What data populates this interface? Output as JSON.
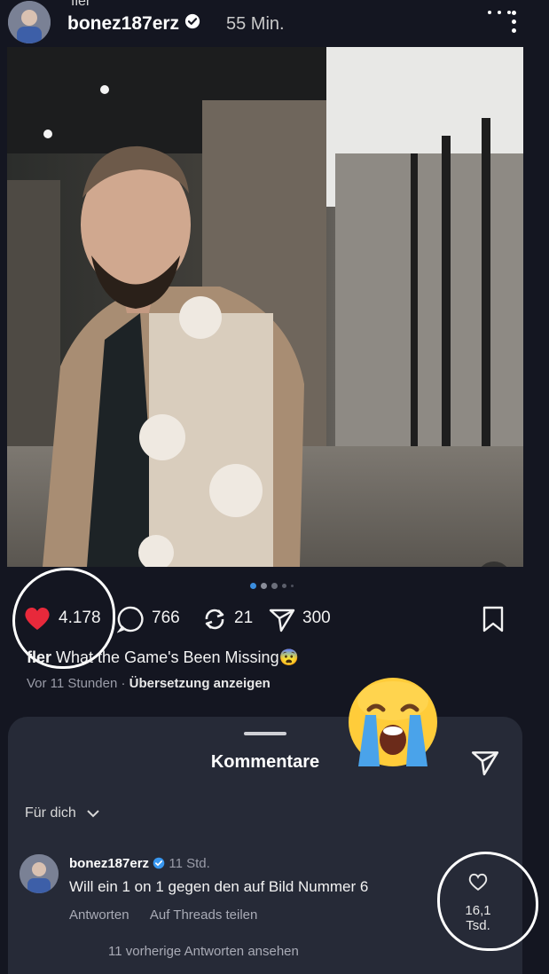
{
  "story": {
    "author_label": "fler",
    "username": "bonez187erz",
    "time": "55 Min."
  },
  "post": {
    "likes": "4.178",
    "comments": "766",
    "reposts": "21",
    "shares": "300",
    "caption_user": "fler",
    "caption_text": "What the Game's Been Missing",
    "caption_emoji": "😨",
    "time": "Vor 11 Stunden",
    "separator": "·",
    "translate_label": "Übersetzung anzeigen",
    "carousel_position": 1,
    "carousel_count": 5
  },
  "overlay_emoji": "😭",
  "comments_sheet": {
    "title": "Kommentare",
    "filter_label": "Für dich",
    "comment": {
      "username": "bonez187erz",
      "time": "11 Std.",
      "text": "Will ein 1 on 1 gegen den auf Bild Nummer 6",
      "reply_label": "Antworten",
      "share_threads_label": "Auf Threads teilen",
      "like_count": "16,1 Tsd."
    },
    "more_replies_label": "11 vorherige Antworten ansehen"
  },
  "colors": {
    "background": "#141621",
    "sheet": "#262a37",
    "like_red": "#e8293b",
    "verified_blue": "#3897f0"
  }
}
